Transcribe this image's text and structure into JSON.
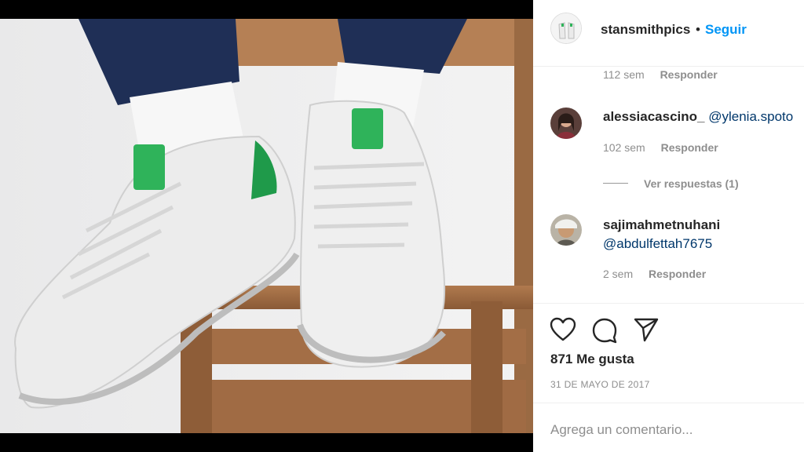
{
  "post": {
    "author": "stansmithpics",
    "separator": "•",
    "follow_label": "Seguir",
    "image_alt": "Pair of white adidas Stan Smith sneakers with green heel tabs on a wooden chair"
  },
  "comments": [
    {
      "time": "112 sem",
      "reply_label": "Responder"
    },
    {
      "username": "alessiacascino_",
      "mention": "@ylenia.spoto",
      "time": "102 sem",
      "reply_label": "Responder",
      "view_replies": "Ver respuestas (1)"
    },
    {
      "username": "sajimahmetnuhani",
      "mention": "@abdulfettah7675",
      "time": "2 sem",
      "reply_label": "Responder"
    }
  ],
  "actions": {
    "like_icon": "heart-icon",
    "comment_icon": "comment-icon",
    "share_icon": "paper-plane-icon",
    "likes": "871 Me gusta",
    "date": "31 DE MAYO DE 2017"
  },
  "composer": {
    "placeholder": "Agrega un comentario..."
  },
  "colors": {
    "accent": "#0095f6",
    "mention": "#00376b",
    "muted": "#8e8e8e",
    "text": "#262626"
  }
}
